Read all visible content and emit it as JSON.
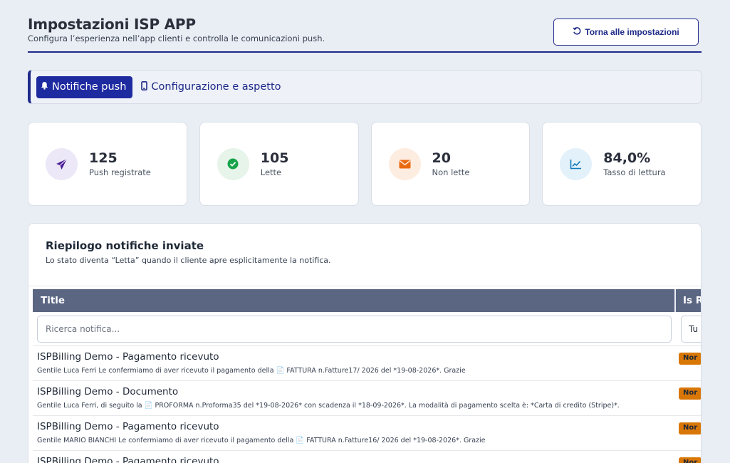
{
  "header": {
    "title": "Impostazioni ISP APP",
    "subtitle": "Configura l’esperienza nell’app clienti e controlla le comunicazioni push.",
    "back_button": "Torna alle impostazioni",
    "back_icon": "rotate-left-icon"
  },
  "tabs": [
    {
      "label": "Notifiche push",
      "icon": "bell-icon",
      "active": true
    },
    {
      "label": "Configurazione e aspetto",
      "icon": "mobile-icon",
      "active": false
    }
  ],
  "stats": [
    {
      "value": "125",
      "label": "Push registrate",
      "icon": "paper-plane-icon",
      "color": "#4c1d95",
      "bg": "#ece8f8"
    },
    {
      "value": "105",
      "label": "Lette",
      "icon": "check-circle-icon",
      "color": "#16a34a",
      "bg": "#e6f4ea"
    },
    {
      "value": "20",
      "label": "Non lette",
      "icon": "envelope-icon",
      "color": "#ea6a12",
      "bg": "#fdece0"
    },
    {
      "value": "84,0%",
      "label": "Tasso di lettura",
      "icon": "chart-line-icon",
      "color": "#0e7ab8",
      "bg": "#e3f1fa"
    }
  ],
  "summary": {
    "title": "Riepilogo notifiche inviate",
    "subtitle": "Lo stato diventa “Letta” quando il cliente apre esplicitamente la notifica."
  },
  "table": {
    "columns": [
      "Title",
      "Is R"
    ],
    "search_placeholder": "Ricerca notifica...",
    "select_value": "Tu",
    "rows": [
      {
        "title": "ISPBilling Demo - Pagamento ricevuto",
        "body": "Gentile Luca Ferri Le confermiamo di aver ricevuto il pagamento della 📄 FATTURA n.Fatture17/ 2026 del *19-08-2026*. Grazie",
        "status": "Nor"
      },
      {
        "title": "ISPBilling Demo - Documento",
        "body": "Gentile Luca Ferri, di seguito la 📄 PROFORMA n.Proforma35 del *19-08-2026* con scadenza il *18-09-2026*. La modalità di pagamento scelta è: *Carta di credito (Stripe)*.",
        "status": "Nor"
      },
      {
        "title": "ISPBilling Demo - Pagamento ricevuto",
        "body": "Gentile MARIO BIANCHI Le confermiamo di aver ricevuto il pagamento della 📄 FATTURA n.Fatture16/ 2026 del *19-08-2026*. Grazie",
        "status": "Nor"
      },
      {
        "title": "ISPBilling Demo - Pagamento ricevuto",
        "body": "",
        "status": "Nor"
      }
    ]
  }
}
